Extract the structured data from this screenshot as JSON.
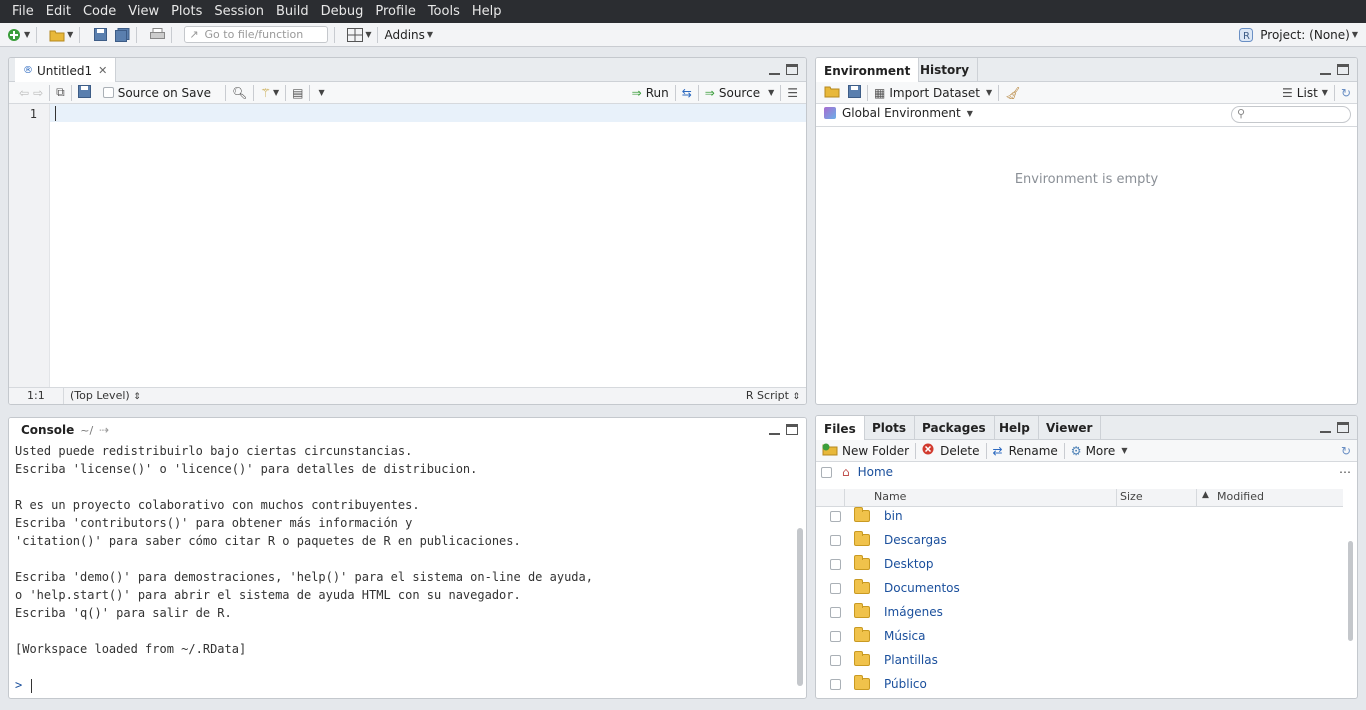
{
  "menu": [
    "File",
    "Edit",
    "Code",
    "View",
    "Plots",
    "Session",
    "Build",
    "Debug",
    "Profile",
    "Tools",
    "Help"
  ],
  "toolbar": {
    "goto_placeholder": "Go to file/function",
    "addins_label": "Addins",
    "project_label": "Project: (None)"
  },
  "editor": {
    "tab_label": "Untitled1",
    "source_on_save_label": "Source on Save",
    "run_label": "Run",
    "source_label": "Source",
    "line_number": "1",
    "cursor_pos": "1:1",
    "scope": "(Top Level)",
    "file_type": "R Script"
  },
  "console": {
    "title": "Console",
    "path": "~/",
    "lines": [
      "Usted puede redistribuirlo bajo ciertas circunstancias.",
      "Escriba 'license()' o 'licence()' para detalles de distribucion.",
      "",
      "R es un proyecto colaborativo con muchos contribuyentes.",
      "Escriba 'contributors()' para obtener más información y",
      "'citation()' para saber cómo citar R o paquetes de R en publicaciones.",
      "",
      "Escriba 'demo()' para demostraciones, 'help()' para el sistema on-line de ayuda,",
      "o 'help.start()' para abrir el sistema de ayuda HTML con su navegador.",
      "Escriba 'q()' para salir de R.",
      "",
      "[Workspace loaded from ~/.RData]",
      "",
      "> "
    ]
  },
  "environment": {
    "tabs": [
      "Environment",
      "History"
    ],
    "import_label": "Import Dataset",
    "list_label": "List",
    "scope_label": "Global Environment",
    "empty_text": "Environment is empty"
  },
  "files": {
    "tabs": [
      "Files",
      "Plots",
      "Packages",
      "Help",
      "Viewer"
    ],
    "new_folder_label": "New Folder",
    "delete_label": "Delete",
    "rename_label": "Rename",
    "more_label": "More",
    "breadcrumb_home": "Home",
    "columns": [
      "Name",
      "Size",
      "Modified"
    ],
    "rows": [
      "bin",
      "Descargas",
      "Desktop",
      "Documentos",
      "Imágenes",
      "Música",
      "Plantillas",
      "Público"
    ]
  },
  "colors": {
    "accent": "#1a4f9c",
    "menubar": "#2b2d31",
    "prompt": "#1a4f9c"
  }
}
